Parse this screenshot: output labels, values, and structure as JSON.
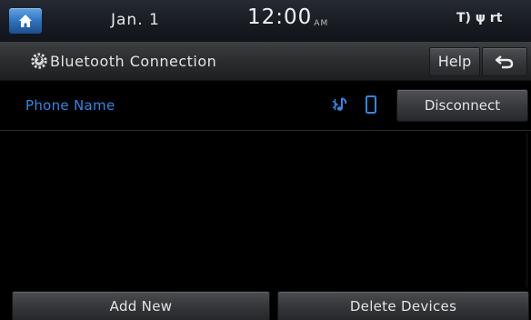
{
  "status_bar": {
    "date": "Jan. 1",
    "time": "12:00",
    "ampm": "AM",
    "indicator_text": "T) ψ rt",
    "home_icon": "home-icon"
  },
  "title_bar": {
    "title": "Bluetooth Connection",
    "help_label": "Help",
    "title_icon": "bluetooth-gear-icon",
    "back_icon": "back-arrow-icon"
  },
  "device": {
    "name": "Phone Name",
    "disconnect_label": "Disconnect",
    "audio_icon": "bluetooth-audio-icon",
    "phone_icon": "phone-icon",
    "name_color": "#2f88e6",
    "icon_color": "#2f88e6"
  },
  "footer": {
    "add_new_label": "Add New",
    "delete_devices_label": "Delete Devices"
  },
  "colors": {
    "accent": "#2f88e6",
    "home_button": "#3a82cc",
    "background": "#000000"
  }
}
